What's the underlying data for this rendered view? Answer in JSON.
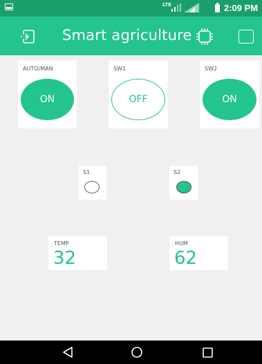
{
  "status_bar": {
    "network": "LTE",
    "time": "2:09 PM"
  },
  "app_bar": {
    "title": "Smart agriculture",
    "icons": [
      "exit-icon",
      "device-icon",
      "square-icon"
    ]
  },
  "widgets": {
    "automan": {
      "label": "AUTO/MAN",
      "state": "ON"
    },
    "sw1": {
      "label": "SW1",
      "state": "OFF"
    },
    "sw2": {
      "label": "SW2",
      "state": "ON"
    },
    "s1": {
      "label": "S1",
      "state": "off"
    },
    "s2": {
      "label": "S2",
      "state": "on"
    },
    "temp": {
      "label": "TEMP",
      "value": "32"
    },
    "hum": {
      "label": "HUM",
      "value": "62"
    }
  },
  "colors": {
    "status_bar": "#1a9f6a",
    "app_bar": "#23c48e",
    "accent": "#23c48e",
    "background": "#f0f0f0",
    "nav_bar": "#000000"
  },
  "nav_bar": {
    "icons": [
      "back-icon",
      "home-icon",
      "recent-apps-icon"
    ]
  }
}
